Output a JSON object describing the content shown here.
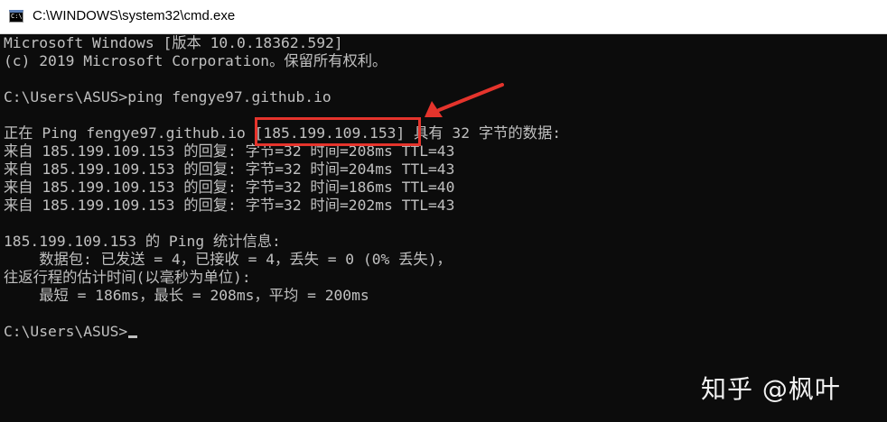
{
  "window": {
    "title": "C:\\WINDOWS\\system32\\cmd.exe",
    "icon": "cmd-icon",
    "icon_text": "C:\\"
  },
  "console": {
    "lines": [
      "Microsoft Windows [版本 10.0.18362.592]",
      "(c) 2019 Microsoft Corporation。保留所有权利。",
      "",
      "C:\\Users\\ASUS>ping fengye97.github.io",
      "",
      "正在 Ping fengye97.github.io [185.199.109.153] 具有 32 字节的数据:",
      "来自 185.199.109.153 的回复: 字节=32 时间=208ms TTL=43",
      "来自 185.199.109.153 的回复: 字节=32 时间=204ms TTL=43",
      "来自 185.199.109.153 的回复: 字节=32 时间=186ms TTL=40",
      "来自 185.199.109.153 的回复: 字节=32 时间=202ms TTL=43",
      "",
      "185.199.109.153 的 Ping 统计信息:",
      "    数据包: 已发送 = 4，已接收 = 4，丢失 = 0 (0% 丢失)，",
      "往返行程的估计时间(以毫秒为单位):",
      "    最短 = 186ms，最长 = 208ms，平均 = 200ms",
      "",
      "C:\\Users\\ASUS>"
    ],
    "text_color": "#c0c0c0",
    "background_color": "#0c0c0c"
  },
  "annotation": {
    "color": "#e5342c"
  },
  "watermark": {
    "text": "知乎 @枫叶"
  }
}
